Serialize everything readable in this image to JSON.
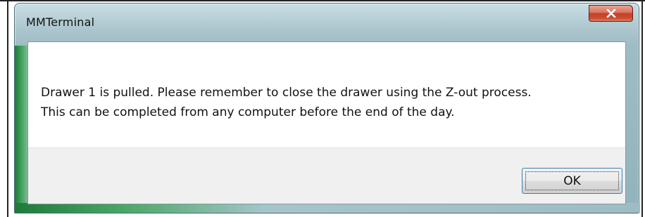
{
  "window": {
    "title": "MMTerminal",
    "close_icon": "close-x-icon"
  },
  "message": {
    "line1": "Drawer 1 is pulled. Please remember to close the drawer using the Z-out process.",
    "line2": "This can be completed from any computer before the end of the day."
  },
  "buttons": {
    "ok_label": "OK"
  },
  "colors": {
    "close_button": "#c54127",
    "ok_border": "#3c7fb1",
    "button_area": "#f0f0f0"
  }
}
